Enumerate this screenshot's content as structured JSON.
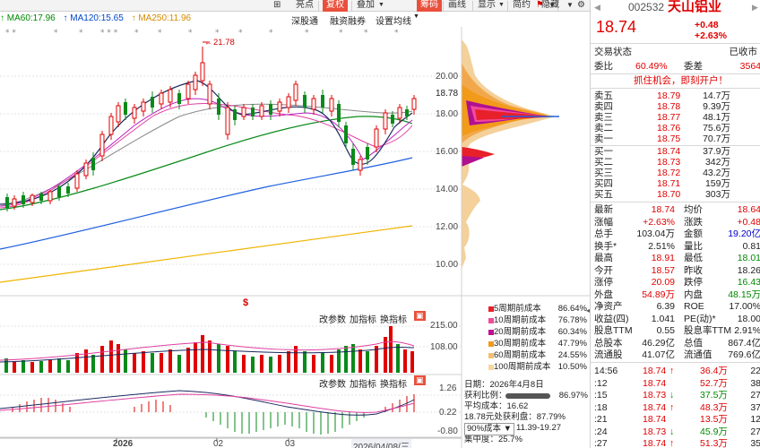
{
  "toolbar": {
    "items": [
      "亮点",
      "复权",
      "叠加",
      "筹码",
      "画线",
      "显示",
      "简约",
      "隐藏"
    ],
    "subitems": [
      "深股通",
      "融资融券",
      "设置均线"
    ]
  },
  "ma_legend": {
    "ma60": "MA60:17.96",
    "ma120": "MA120:15.65",
    "ma250": "MA250:11.96"
  },
  "chart": {
    "high_marker": "21.78",
    "price_axis": [
      "20.00",
      "18.00",
      "16.00",
      "14.00",
      "12.00",
      "10.00"
    ],
    "current_price_tag": "18.78",
    "volume_axis": [
      "215.00",
      "108.00"
    ],
    "macd_axis": [
      "1.26",
      "0.22",
      "-0.80"
    ],
    "date_axis": [
      "2026",
      "02",
      "03",
      "2026/04/08/三"
    ],
    "panel_buttons_volume": [
      "改参数",
      "加指标",
      "换指标"
    ],
    "panel_buttons_macd": [
      "改参数",
      "加指标",
      "换指标"
    ],
    "marker_dollar": "$"
  },
  "chip": {
    "legend": [
      {
        "label": "5周期前成本",
        "value": "86.64%",
        "color": "#e8202a"
      },
      {
        "label": "10周期前成本",
        "value": "76.78%",
        "color": "#f24a9a"
      },
      {
        "label": "20周期前成本",
        "value": "60.34%",
        "color": "#c01090"
      },
      {
        "label": "30周期前成本",
        "value": "47.79%",
        "color": "#f29a1a"
      },
      {
        "label": "60周期前成本",
        "value": "24.55%",
        "color": "#f4c070"
      },
      {
        "label": "100周期前成本",
        "value": "10.50%",
        "color": "#f4d8a0"
      }
    ],
    "date_label": "日期：2026年4月8日",
    "profit_ratio_label": "获利比例：",
    "profit_ratio_value": "86.97%",
    "avg_cost": "平均成本：16.62",
    "profit_at": "18.78元处获利盘：87.79%",
    "cost_range_select": "90%成本",
    "cost_range": "11.39-19.27",
    "concentration": "集中度：25.7%"
  },
  "quote": {
    "code": "002532",
    "name": "天山铝业",
    "price": "18.74",
    "change": "+0.48",
    "change_pct": "+2.63%",
    "status_label": "交易状态",
    "status_value": "已收市",
    "weibi_label": "委比",
    "weibi_value": "60.49%",
    "weicha_label": "委差",
    "weicha_value": "3564",
    "promo": "抓住机会，即刻开户！",
    "asks": [
      {
        "label": "卖五",
        "price": "18.79",
        "vol": "14.7万"
      },
      {
        "label": "卖四",
        "price": "18.78",
        "vol": "9.39万"
      },
      {
        "label": "卖三",
        "price": "18.77",
        "vol": "48.1万"
      },
      {
        "label": "卖二",
        "price": "18.76",
        "vol": "75.6万"
      },
      {
        "label": "卖一",
        "price": "18.75",
        "vol": "70.7万"
      }
    ],
    "bids": [
      {
        "label": "买一",
        "price": "18.74",
        "vol": "37.9万"
      },
      {
        "label": "买二",
        "price": "18.73",
        "vol": "342万"
      },
      {
        "label": "买三",
        "price": "18.72",
        "vol": "43.2万"
      },
      {
        "label": "买四",
        "price": "18.71",
        "vol": "159万"
      },
      {
        "label": "买五",
        "price": "18.70",
        "vol": "303万"
      }
    ],
    "stats": [
      {
        "l1": "最新",
        "v1": "18.74",
        "c1": "red",
        "l2": "均价",
        "v2": "18.64",
        "c2": "red"
      },
      {
        "l1": "涨幅",
        "v1": "+2.63%",
        "c1": "red",
        "l2": "涨跌",
        "v2": "+0.48",
        "c2": "red"
      },
      {
        "l1": "总手",
        "v1": "103.04万",
        "c1": "dark",
        "l2": "金额",
        "v2": "19.20亿",
        "c2": "blue"
      },
      {
        "l1": "换手*",
        "v1": "2.51%",
        "c1": "dark",
        "l2": "量比",
        "v2": "0.81",
        "c2": "dark"
      },
      {
        "l1": "最高",
        "v1": "18.91",
        "c1": "red",
        "l2": "最低",
        "v2": "18.01",
        "c2": "green"
      },
      {
        "l1": "今开",
        "v1": "18.57",
        "c1": "red",
        "l2": "昨收",
        "v2": "18.26",
        "c2": "dark"
      },
      {
        "l1": "涨停",
        "v1": "20.09",
        "c1": "red",
        "l2": "跌停",
        "v2": "16.43",
        "c2": "green"
      },
      {
        "l1": "外盘",
        "v1": "54.89万",
        "c1": "red",
        "l2": "内盘",
        "v2": "48.15万",
        "c2": "green"
      },
      {
        "l1": "净资产",
        "v1": "6.39",
        "c1": "dark",
        "l2": "ROE",
        "v2": "17.00%",
        "c2": "dark"
      },
      {
        "l1": "收益(四)",
        "v1": "1.041",
        "c1": "dark",
        "l2": "PE(动)*",
        "v2": "18.00",
        "c2": "dark"
      },
      {
        "l1": "股息TTM",
        "v1": "0.55",
        "c1": "dark",
        "l2": "股息率TTM",
        "v2": "2.91%",
        "c2": "dark"
      },
      {
        "l1": "总股本",
        "v1": "46.29亿",
        "c1": "dark",
        "l2": "总值",
        "v2": "867.4亿",
        "c2": "dark"
      },
      {
        "l1": "流通股",
        "v1": "41.07亿",
        "c1": "dark",
        "l2": "流通值",
        "v2": "769.6亿",
        "c2": "dark"
      }
    ],
    "ticks": [
      {
        "time": "14:56",
        "price": "18.74",
        "arrow": "↑",
        "vol": "36.4万",
        "n": "22"
      },
      {
        "time": ":12",
        "price": "18.74",
        "arrow": "",
        "vol": "52.7万",
        "n": "38"
      },
      {
        "time": ":15",
        "price": "18.73",
        "arrow": "↓",
        "vol": "37.5万",
        "n": "27"
      },
      {
        "time": ":18",
        "price": "18.74",
        "arrow": "↑",
        "vol": "48.3万",
        "n": "37"
      },
      {
        "time": ":21",
        "price": "18.74",
        "arrow": "",
        "vol": "13.5万",
        "n": "12"
      },
      {
        "time": ":24",
        "price": "18.73",
        "arrow": "↓",
        "vol": "45.9万",
        "n": "27"
      },
      {
        "time": ":27",
        "price": "18.74",
        "arrow": "↑",
        "vol": "51.3万",
        "n": "35"
      }
    ]
  }
}
